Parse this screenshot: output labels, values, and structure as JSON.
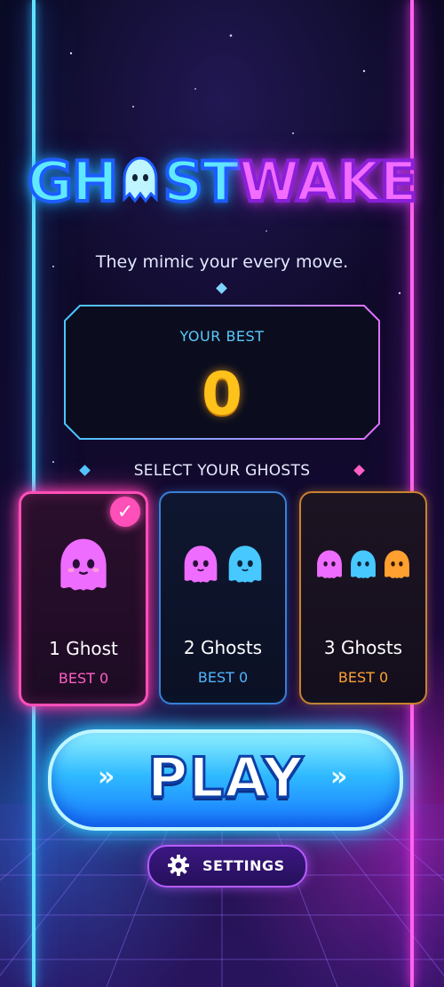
{
  "title": {
    "part1_a": "GH",
    "part1_b": "ST",
    "part2": "WAKE"
  },
  "tagline": "They mimic your every move.",
  "best_panel": {
    "label": "YOUR BEST",
    "value": "0"
  },
  "select_label": "SELECT YOUR GHOSTS",
  "cards": [
    {
      "name": "1 Ghost",
      "best": "BEST 0",
      "selected": true,
      "accent": "#ff4fb8"
    },
    {
      "name": "2 Ghosts",
      "best": "BEST 0",
      "selected": false,
      "accent": "#3a7fd6"
    },
    {
      "name": "3 Ghosts",
      "best": "BEST 0",
      "selected": false,
      "accent": "#c9822e"
    }
  ],
  "play_label": "PLAY",
  "settings_label": "SETTINGS",
  "icons": {
    "check": "checkmark-icon",
    "settings": "gear-icon",
    "play_arrows": "double-chevron-icon"
  },
  "colors": {
    "cyan": "#5fe3ff",
    "magenta": "#ff63f0",
    "gold": "#ffc21a",
    "pink_ghost": "#ee6cff",
    "blue_ghost": "#47c8ff",
    "orange_ghost": "#ffa030"
  }
}
